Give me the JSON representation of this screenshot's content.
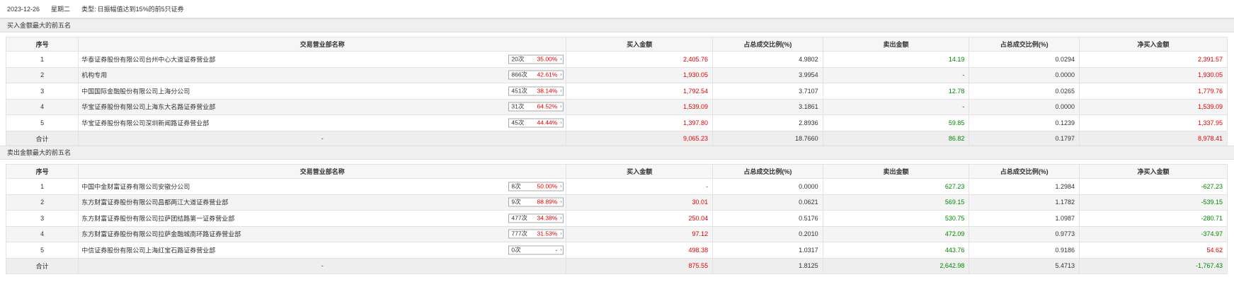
{
  "header": {
    "date": "2023-12-26",
    "weekday": "星期二",
    "type_label": "类型:",
    "type_value": "日振幅值达到15%的前5只证券"
  },
  "colors": {
    "up": "#e60000",
    "down": "#008800"
  },
  "columns": [
    "序号",
    "交易营业部名称",
    "买入金额",
    "占总成交比例(%)",
    "卖出金额",
    "占总成交比例(%)",
    "净买入金额"
  ],
  "buy_section": {
    "title": "买入金额最大的前五名",
    "rows": [
      {
        "no": "1",
        "name": "华泰证券股份有限公司台州中心大道证券营业部",
        "count": "20次",
        "pct": "35.00%",
        "buy": "2,405.76",
        "buy_ratio": "4.9802",
        "sell": "14.19",
        "sell_ratio": "0.0294",
        "net": "2,391.57"
      },
      {
        "no": "2",
        "name": "机构专用",
        "count": "866次",
        "pct": "42.61%",
        "buy": "1,930.05",
        "buy_ratio": "3.9954",
        "sell": "-",
        "sell_ratio": "0.0000",
        "net": "1,930.05"
      },
      {
        "no": "3",
        "name": "中国国际金融股份有限公司上海分公司",
        "count": "451次",
        "pct": "38.14%",
        "buy": "1,792.54",
        "buy_ratio": "3.7107",
        "sell": "12.78",
        "sell_ratio": "0.0265",
        "net": "1,779.76"
      },
      {
        "no": "4",
        "name": "华宝证券股份有限公司上海东大名路证券营业部",
        "count": "31次",
        "pct": "64.52%",
        "buy": "1,539.09",
        "buy_ratio": "3.1861",
        "sell": "-",
        "sell_ratio": "0.0000",
        "net": "1,539.09"
      },
      {
        "no": "5",
        "name": "华宝证券股份有限公司深圳新闻路证券营业部",
        "count": "45次",
        "pct": "44.44%",
        "buy": "1,397.80",
        "buy_ratio": "2.8936",
        "sell": "59.85",
        "sell_ratio": "0.1239",
        "net": "1,337.95"
      }
    ],
    "total": {
      "label": "合计",
      "name": "-",
      "buy": "9,065.23",
      "buy_ratio": "18.7660",
      "sell": "86.82",
      "sell_ratio": "0.1797",
      "net": "8,978.41"
    }
  },
  "sell_section": {
    "title": "卖出金额最大的前五名",
    "rows": [
      {
        "no": "1",
        "name": "中国中金财富证券有限公司安徽分公司",
        "count": "8次",
        "pct": "50.00%",
        "buy": "-",
        "buy_ratio": "0.0000",
        "sell": "627.23",
        "sell_ratio": "1.2984",
        "net": "-627.23"
      },
      {
        "no": "2",
        "name": "东方财富证券股份有限公司昌都两江大道证券营业部",
        "count": "9次",
        "pct": "88.89%",
        "buy": "30.01",
        "buy_ratio": "0.0621",
        "sell": "569.15",
        "sell_ratio": "1.1782",
        "net": "-539.15"
      },
      {
        "no": "3",
        "name": "东方财富证券股份有限公司拉萨团结路第一证券营业部",
        "count": "477次",
        "pct": "34.38%",
        "buy": "250.04",
        "buy_ratio": "0.5176",
        "sell": "530.75",
        "sell_ratio": "1.0987",
        "net": "-280.71"
      },
      {
        "no": "4",
        "name": "东方财富证券股份有限公司拉萨金融城南环路证券营业部",
        "count": "777次",
        "pct": "31.53%",
        "buy": "97.12",
        "buy_ratio": "0.2010",
        "sell": "472.09",
        "sell_ratio": "0.9773",
        "net": "-374.97"
      },
      {
        "no": "5",
        "name": "中信证券股份有限公司上海红宝石路证券营业部",
        "count": "0次",
        "pct": "-",
        "buy": "498.38",
        "buy_ratio": "1.0317",
        "sell": "443.76",
        "sell_ratio": "0.9186",
        "net": "54.62"
      }
    ],
    "total": {
      "label": "合计",
      "name": "-",
      "buy": "875.55",
      "buy_ratio": "1.8125",
      "sell": "2,642.98",
      "sell_ratio": "5.4713",
      "net": "-1,767.43"
    }
  }
}
